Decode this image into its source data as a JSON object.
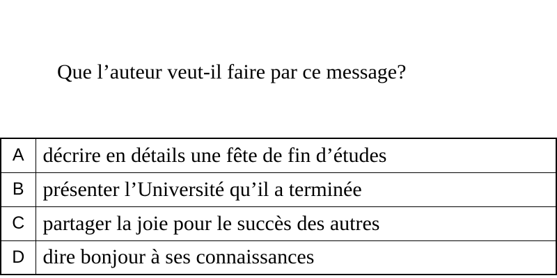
{
  "question": "Que l’auteur veut-il faire par ce message?",
  "options": [
    {
      "letter": "A",
      "text": "décrire en détails une fête de fin d’études"
    },
    {
      "letter": "B",
      "text": "présenter l’Université qu’il a terminée"
    },
    {
      "letter": "C",
      "text": "partager la joie pour le succès des autres"
    },
    {
      "letter": "D",
      "text": "dire bonjour à ses connaissances"
    }
  ]
}
